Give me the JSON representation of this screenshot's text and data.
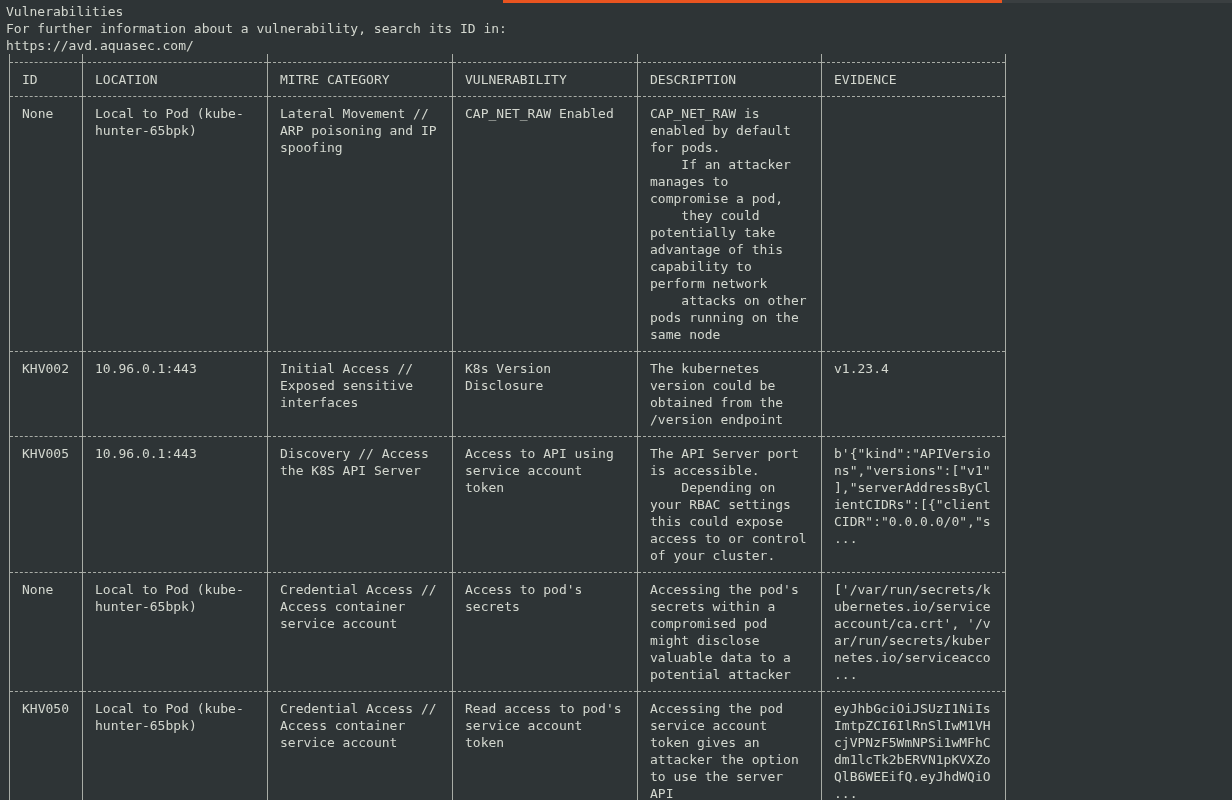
{
  "heading": {
    "title": "Vulnerabilities",
    "info": "For further information about a vulnerability, search its ID in:",
    "url": "https://avd.aquasec.com/"
  },
  "table": {
    "columns": [
      "ID",
      "LOCATION",
      "MITRE CATEGORY",
      "VULNERABILITY",
      "DESCRIPTION",
      "EVIDENCE"
    ],
    "rows": [
      {
        "id": "None",
        "location": "Local to Pod (kube-\nhunter-65bpk)",
        "mitre_category": "Lateral Movement //\nARP poisoning and IP\nspoofing",
        "vulnerability": "CAP_NET_RAW Enabled",
        "description": "CAP_NET_RAW is\nenabled by default\nfor pods.\n    If an attacker\nmanages to\ncompromise a pod,\n    they could\npotentially take\nadvantage of this\ncapability to\nperform network\n    attacks on other\npods running on the\nsame node"
      },
      {
        "id": "KHV002",
        "location": "10.96.0.1:443",
        "mitre_category": "Initial Access //\nExposed sensitive\ninterfaces",
        "vulnerability": "K8s Version\nDisclosure",
        "description": "The kubernetes\nversion could be\nobtained from the\n/version endpoint",
        "evidence": "v1.23.4"
      },
      {
        "id": "KHV005",
        "location": "10.96.0.1:443",
        "mitre_category": "Discovery // Access\nthe K8S API Server",
        "vulnerability": "Access to API using\nservice account\ntoken",
        "description": "The API Server port\nis accessible.\n    Depending on\nyour RBAC settings\nthis could expose\naccess to or control\nof your cluster.",
        "evidence": "b'{\"kind\":\"APIVersio\nns\",\"versions\":[\"v1\"\n],\"serverAddressByCl\nientCIDRs\":[{\"client\nCIDR\":\"0.0.0.0/0\",\"s\n..."
      },
      {
        "id": "None",
        "location": "Local to Pod (kube-\nhunter-65bpk)",
        "mitre_category": "Credential Access //\nAccess container\nservice account",
        "vulnerability": "Access to pod's\nsecrets",
        "description": "Accessing the pod's\nsecrets within a\ncompromised pod\nmight disclose\nvaluable data to a\npotential attacker",
        "evidence": "['/var/run/secrets/k\nubernetes.io/service\naccount/ca.crt', '/v\nar/run/secrets/kuber\nnetes.io/serviceacco\n..."
      },
      {
        "id": "KHV050",
        "location": "Local to Pod (kube-\nhunter-65bpk)",
        "mitre_category": "Credential Access //\nAccess container\nservice account",
        "vulnerability": "Read access to pod's\nservice account\ntoken",
        "description": "Accessing the pod\nservice account\ntoken gives an\nattacker the option\nto use the server\nAPI",
        "evidence": "eyJhbGciOiJSUzI1NiIs\nImtpZCI6IlRnSlIwM1VH\ncjVPNzF5WmNPSi1wMFhC\ndm1lcTk2bERVN1pKVXZo\nQlB6WEEifQ.eyJhdWQiO\n..."
      }
    ]
  }
}
